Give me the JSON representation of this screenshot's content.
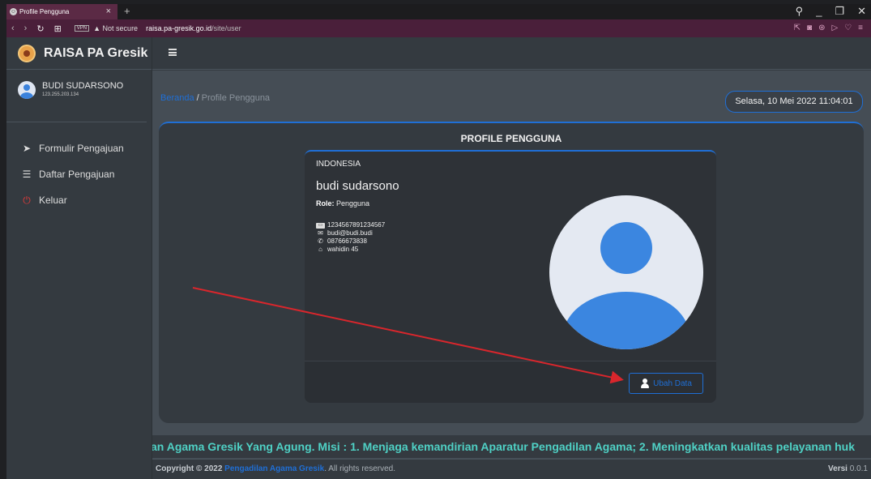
{
  "browser": {
    "tab_title": "Profile Pengguna",
    "url_security": "Not secure",
    "url_domain": "raisa.pa-gresik.go.id",
    "url_path": "/site/user",
    "vpn_label": "VPN"
  },
  "sidebar": {
    "brand": "RAISA PA Gresik",
    "user_name": "BUDI SUDARSONO",
    "user_ip": "123.255.203.134",
    "items": [
      {
        "label": "Formulir Pengajuan",
        "icon": "paper-plane-icon"
      },
      {
        "label": "Daftar Pengajuan",
        "icon": "list-icon"
      },
      {
        "label": "Keluar",
        "icon": "power-icon"
      }
    ]
  },
  "breadcrumb": {
    "home": "Beranda",
    "separator": "/",
    "current": "Profile Pengguna"
  },
  "datetime": "Selasa, 10 Mei 2022 11:04:01",
  "profile": {
    "title": "PROFILE PENGGUNA",
    "country": "INDONESIA",
    "name": "budi sudarsono",
    "role_label": "Role:",
    "role_value": "Pengguna",
    "id_number": "1234567891234567",
    "email": "budi@budi.budi",
    "phone": "08766673838",
    "address": "wahidin 45",
    "edit_button": "Ubah Data"
  },
  "marquee_text": "an Agama Gresik Yang Agung. Misi : 1. Menjaga kemandirian Aparatur Pengadilan Agama; 2. Meningkatkan kualitas pelayanan huk",
  "footer": {
    "copyright": "Copyright © 2022",
    "org": "Pengadilan Agama Gresik",
    "rights": ". All rights reserved.",
    "version_label": "Versi",
    "version_value": "0.0.1"
  },
  "colors": {
    "accent": "#1f6fd6",
    "marquee": "#4fd1c5",
    "annotation_arrow": "#d9262c"
  }
}
